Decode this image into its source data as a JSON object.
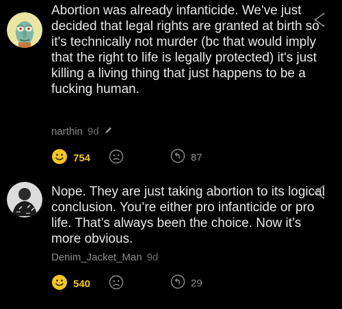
{
  "comments": [
    {
      "text": "Abortion was already infanticide. We've just decided that legal rights are granted at birth so it's technically not murder (bc that would imply that the right to life is legally protected) it's just killing a living thing that just happens to be a fucking human.",
      "username": "narthin",
      "age": "9d",
      "smile_count": "754",
      "reply_count": "87"
    },
    {
      "text": "Nope. They are just taking abortion to its logical conclusion. You’re either pro infanticide or pro life. That’s always been the choice. Now it’s more obvious.",
      "username": "Denim_Jacket_Man",
      "age": "9d",
      "smile_count": "540",
      "reply_count": "29"
    }
  ],
  "colors": {
    "background": "#000000",
    "text": "#e8e8e8",
    "meta": "#8d8d8d",
    "smile": "#f3c623"
  },
  "icons": [
    "share-icon",
    "pencil-icon",
    "smile-icon",
    "frown-icon",
    "reply-icon"
  ]
}
